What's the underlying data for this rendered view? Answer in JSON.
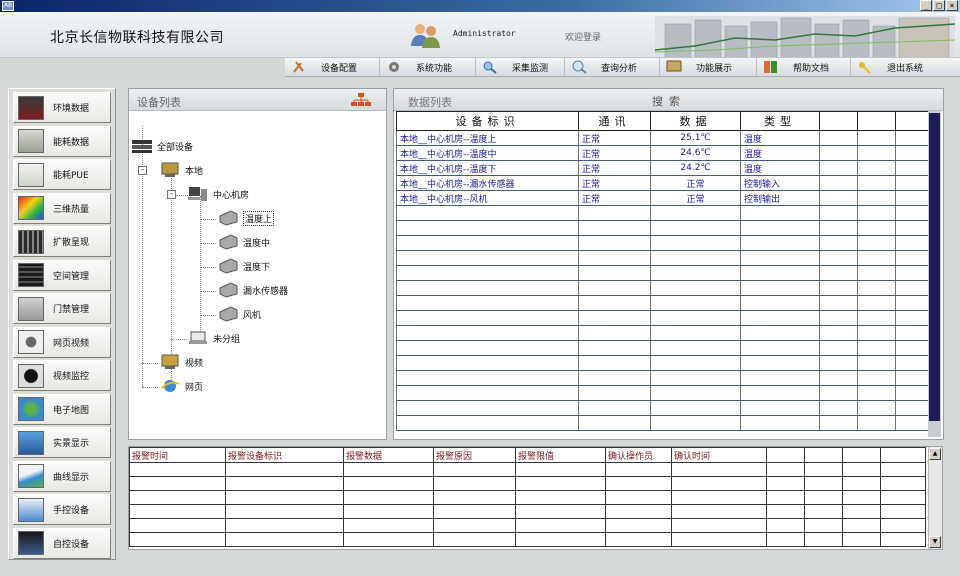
{
  "header": {
    "company": "北京长信物联科技有限公司",
    "admin": "Administrator",
    "welcome": "欢迎登录"
  },
  "nav": [
    {
      "label": "设备配置",
      "icon": "tools-icon"
    },
    {
      "label": "系统功能",
      "icon": "gear-icon"
    },
    {
      "label": "采集监测",
      "icon": "magnifier-icon"
    },
    {
      "label": "查询分析",
      "icon": "search-analysis-icon"
    },
    {
      "label": "功能展示",
      "icon": "monitor-icon"
    },
    {
      "label": "帮助文档",
      "icon": "book-icon"
    },
    {
      "label": "退出系统",
      "icon": "key-icon"
    }
  ],
  "menu": [
    {
      "label": "环境数据",
      "icon": "thermometer-icon"
    },
    {
      "label": "能耗数据",
      "icon": "meter-icon"
    },
    {
      "label": "能耗PUE",
      "icon": "chart-icon"
    },
    {
      "label": "三维热量",
      "icon": "heatmap-icon"
    },
    {
      "label": "扩散呈现",
      "icon": "diffusion-icon"
    },
    {
      "label": "空间管理",
      "icon": "rack-icon"
    },
    {
      "label": "门禁管理",
      "icon": "door-icon"
    },
    {
      "label": "网页视频",
      "icon": "webcam-icon"
    },
    {
      "label": "视频监控",
      "icon": "camera-icon"
    },
    {
      "label": "电子地图",
      "icon": "globe-icon"
    },
    {
      "label": "实景显示",
      "icon": "screen-icon"
    },
    {
      "label": "曲线显示",
      "icon": "curve-icon"
    },
    {
      "label": "手控设备",
      "icon": "hand-icon"
    },
    {
      "label": "自控设备",
      "icon": "auto-icon"
    }
  ],
  "tree": {
    "title": "设备列表",
    "root": "全部设备",
    "local": "本地",
    "room": "中心机房",
    "devices": [
      "温度上",
      "温度中",
      "温度下",
      "漏水传感器",
      "风机"
    ],
    "ungrouped": "未分组",
    "video": "视频",
    "web": "网页"
  },
  "data": {
    "title": "数据列表",
    "search": "搜索",
    "columns": [
      "设备标识",
      "通讯",
      "数据",
      "类型"
    ],
    "rows": [
      [
        "本地__中心机房--温度上",
        "正常",
        "25.1℃",
        "温度"
      ],
      [
        "本地__中心机房--温度中",
        "正常",
        "24.6℃",
        "温度"
      ],
      [
        "本地__中心机房--温度下",
        "正常",
        "24.2℃",
        "温度"
      ],
      [
        "本地__中心机房--漏水传感器",
        "正常",
        "正常",
        "控制输入"
      ],
      [
        "本地__中心机房--风机",
        "正常",
        "正常",
        "控制输出"
      ]
    ]
  },
  "alarm": {
    "columns": [
      "报警时间",
      "报警设备标识",
      "报警数据",
      "报警原因",
      "报警限值",
      "确认操作员",
      "确认时间"
    ]
  }
}
